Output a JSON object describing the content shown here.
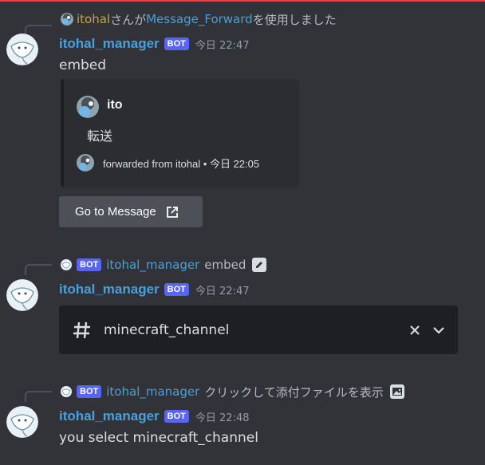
{
  "colors": {
    "background": "#313338",
    "bot_tag": "#5865f2",
    "username": "#4aa0dc",
    "mention_user": "#c9a24a",
    "mention_blue": "#4b9ed8",
    "top_border": "#f23f43"
  },
  "message1": {
    "reply": {
      "user": "itohal",
      "text1": "さんが",
      "command": "Message_Forward",
      "text2": "を使用しました"
    },
    "author": "itohal_manager",
    "bot_tag": "BOT",
    "timestamp": "今日 22:47",
    "content": "embed",
    "embed": {
      "author": "ito",
      "description": "転送",
      "footer": "forwarded from itohal",
      "footer_sep": "•",
      "footer_time": "今日 22:05"
    },
    "button": {
      "label": "Go to Message",
      "icon": "external-link-icon"
    }
  },
  "message2": {
    "reply": {
      "bot_tag": "BOT",
      "user": "itohal_manager",
      "text": "embed",
      "icon": "edit-icon"
    },
    "author": "itohal_manager",
    "bot_tag": "BOT",
    "timestamp": "今日 22:47",
    "select": {
      "icon": "hash-icon",
      "value": "minecraft_channel",
      "clear_icon": "close-icon",
      "dropdown_icon": "chevron-down-icon"
    }
  },
  "message3": {
    "reply": {
      "bot_tag": "BOT",
      "user": "itohal_manager",
      "text": "クリックして添付ファイルを表示",
      "icon": "image-icon"
    },
    "author": "itohal_manager",
    "bot_tag": "BOT",
    "timestamp": "今日 22:48",
    "content": "you select minecraft_channel"
  }
}
